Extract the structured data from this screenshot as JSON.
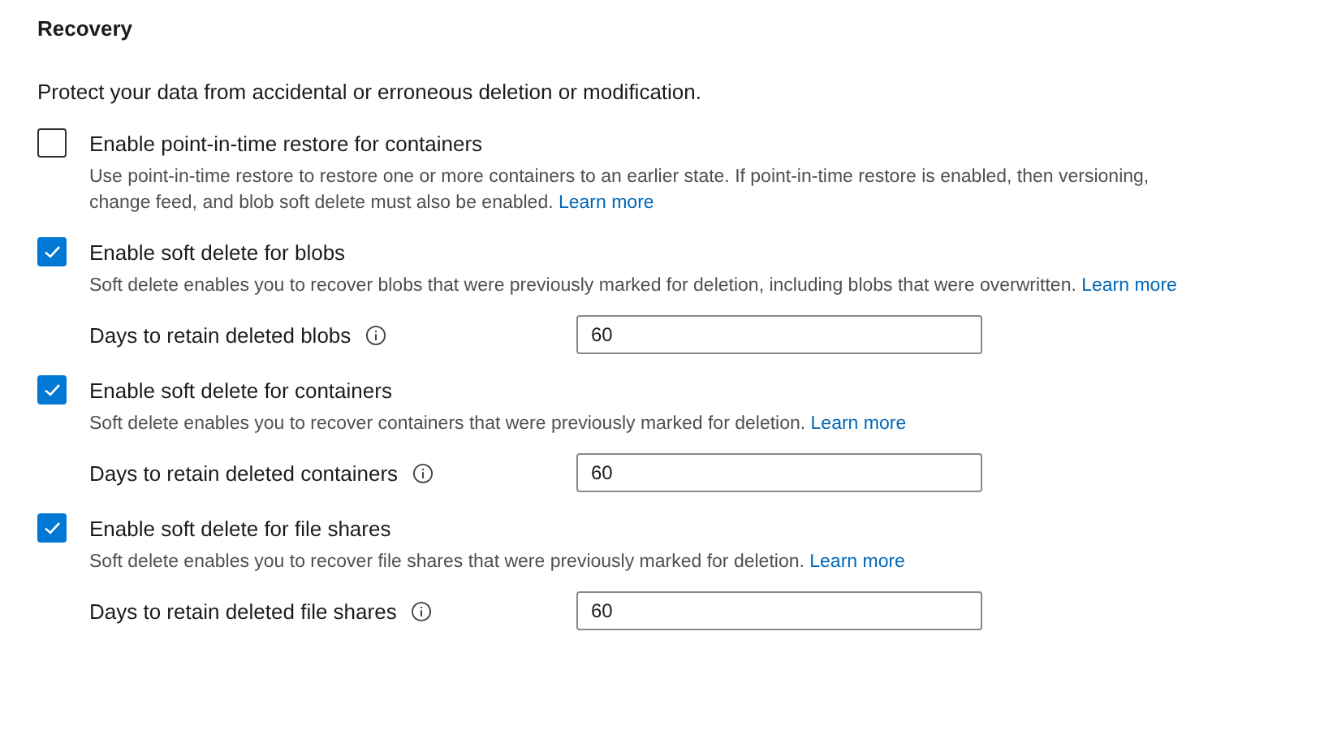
{
  "section": {
    "title": "Recovery",
    "description": "Protect your data from accidental or erroneous deletion or modification."
  },
  "options": [
    {
      "label": "Enable point-in-time restore for containers",
      "checked": false,
      "description": "Use point-in-time restore to restore one or more containers to an earlier state. If point-in-time restore is enabled, then versioning, change feed, and blob soft delete must also be enabled.",
      "link": "Learn more"
    },
    {
      "label": "Enable soft delete for blobs",
      "checked": true,
      "description": "Soft delete enables you to recover blobs that were previously marked for deletion, including blobs that were overwritten.",
      "link": "Learn more",
      "field": {
        "label": "Days to retain deleted blobs",
        "value": "60"
      }
    },
    {
      "label": "Enable soft delete for containers",
      "checked": true,
      "description": "Soft delete enables you to recover containers that were previously marked for deletion.",
      "link": "Learn more",
      "field": {
        "label": "Days to retain deleted containers",
        "value": "60"
      }
    },
    {
      "label": "Enable soft delete for file shares",
      "checked": true,
      "description": "Soft delete enables you to recover file shares that were previously marked for deletion.",
      "link": "Learn more",
      "field": {
        "label": "Days to retain deleted file shares",
        "value": "60"
      }
    }
  ]
}
